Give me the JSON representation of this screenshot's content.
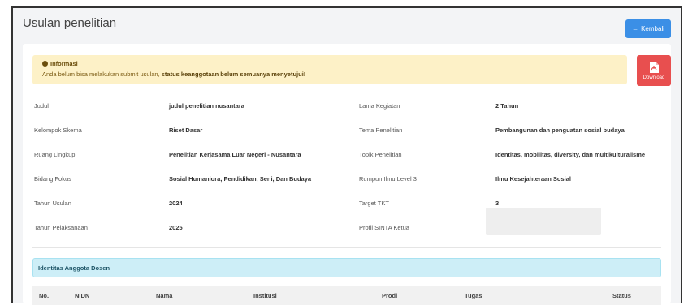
{
  "page": {
    "title": "Usulan penelitian",
    "back_label": "Kembali"
  },
  "alert": {
    "title": "Informasi",
    "message_plain": "Anda belum bisa melakukan submit usulan, ",
    "message_bold": "status keanggotaan belum semuanya menyetujui!"
  },
  "download": {
    "label": "Download"
  },
  "fields_left": [
    {
      "label": "Judul",
      "value": "judul penelitian nusantara"
    },
    {
      "label": "Kelompok Skema",
      "value": "Riset Dasar"
    },
    {
      "label": "Ruang Lingkup",
      "value": "Penelitian Kerjasama Luar Negeri - Nusantara"
    },
    {
      "label": "Bidang Fokus",
      "value": "Sosial Humaniora, Pendidikan, Seni, Dan Budaya"
    },
    {
      "label": "Tahun Usulan",
      "value": "2024"
    },
    {
      "label": "Tahun Pelaksanaan",
      "value": "2025"
    }
  ],
  "fields_right": [
    {
      "label": "Lama Kegiatan",
      "value": "2 Tahun"
    },
    {
      "label": "Tema Penelitian",
      "value": "Pembangunan dan penguatan sosial budaya"
    },
    {
      "label": "Topik Penelitian",
      "value": "Identitas, mobilitas, diversity, dan multikulturalisme"
    },
    {
      "label": "Rumpun Ilmu Level 3",
      "value": "Ilmu Kesejahteraan Sosial"
    },
    {
      "label": "Target TKT",
      "value": "3"
    },
    {
      "label": "Profil SINTA Ketua",
      "value": ""
    }
  ],
  "members": {
    "title": "Identitas Anggota Dosen",
    "columns": [
      "No.",
      "NIDN",
      "Nama",
      "Institusi",
      "Prodi",
      "Tugas",
      "Status"
    ]
  },
  "colors": {
    "primary": "#3b8fe6",
    "danger": "#e84f4f",
    "warning_bg": "#fdf1c7",
    "info_bg": "#cdeef7"
  }
}
